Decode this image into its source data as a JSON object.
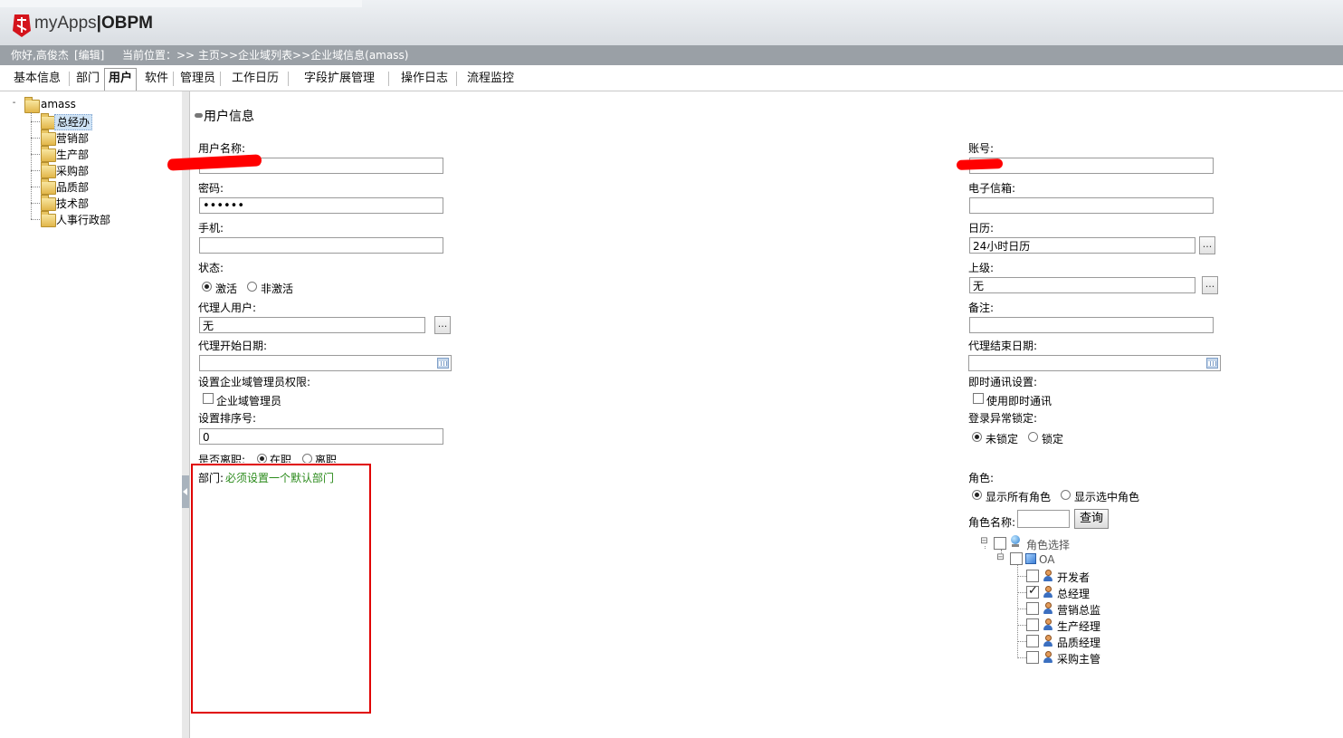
{
  "app": {
    "logo_text": "myApps",
    "logo_separator": "|",
    "product": "OBPM"
  },
  "status_bar": {
    "greeting": "你好,高俊杰",
    "edit_link": "[编辑]",
    "location": "当前位置：>> 主页>>企业域列表>>企业域信息(amass)"
  },
  "tabs": [
    {
      "label": "基本信息"
    },
    {
      "label": "部门"
    },
    {
      "label": "用户",
      "active": true
    },
    {
      "label": "软件"
    },
    {
      "label": "管理员"
    },
    {
      "label": "工作日历"
    },
    {
      "label": "字段扩展管理"
    },
    {
      "label": "操作日志"
    },
    {
      "label": "流程监控"
    }
  ],
  "sidebar": {
    "root": {
      "label": "amass"
    },
    "items": [
      {
        "label": "总经办",
        "selected": true
      },
      {
        "label": "营销部"
      },
      {
        "label": "生产部"
      },
      {
        "label": "采购部"
      },
      {
        "label": "品质部"
      },
      {
        "label": "技术部"
      },
      {
        "label": "人事行政部"
      }
    ]
  },
  "section_title": "用户信息",
  "form_left": {
    "username_label": "用户名称:",
    "username_value": "",
    "password_label": "密码:",
    "password_value": "••••••",
    "mobile_label": "手机:",
    "mobile_value": "",
    "status_label": "状态:",
    "status_options": [
      {
        "label": "激活",
        "checked": true
      },
      {
        "label": "非激活",
        "checked": false
      }
    ],
    "proxy_user_label": "代理人用户:",
    "proxy_user_value": "无",
    "proxy_start_label": "代理开始日期:",
    "proxy_start_value": "",
    "admin_perm_label": "设置企业域管理员权限:",
    "admin_checkbox_label": "企业域管理员",
    "sort_label": "设置排序号:",
    "sort_value": "0",
    "resign_label": "是否离职:",
    "resign_options": [
      {
        "label": "在职",
        "checked": true
      },
      {
        "label": "离职",
        "checked": false
      }
    ],
    "dept_label": "部门:",
    "dept_hint": "必须设置一个默认部门"
  },
  "form_right": {
    "account_label": "账号:",
    "account_value": "",
    "email_label": "电子信箱:",
    "email_value": "",
    "calendar_label": "日历:",
    "calendar_value": "24小时日历",
    "superior_label": "上级:",
    "superior_value": "无",
    "remark_label": "备注:",
    "remark_value": "",
    "proxy_end_label": "代理结束日期:",
    "proxy_end_value": "",
    "im_label": "即时通讯设置:",
    "im_checkbox_label": "使用即时通讯",
    "lock_label": "登录异常锁定:",
    "lock_options": [
      {
        "label": "未锁定",
        "checked": true
      },
      {
        "label": "锁定",
        "checked": false
      }
    ],
    "role_label": "角色:",
    "role_show_options": [
      {
        "label": "显示所有角色",
        "checked": true
      },
      {
        "label": "显示选中角色",
        "checked": false
      }
    ],
    "role_name_label": "角色名称:",
    "role_name_value": "",
    "query_button": "查询",
    "dots_button": "..."
  },
  "role_tree": {
    "root_label": "角色选择",
    "group_label": "OA",
    "roles": [
      {
        "label": "开发者",
        "checked": false
      },
      {
        "label": "总经理",
        "checked": true
      },
      {
        "label": "营销总监",
        "checked": false
      },
      {
        "label": "生产经理",
        "checked": false
      },
      {
        "label": "品质经理",
        "checked": false
      },
      {
        "label": "采购主管",
        "checked": false
      }
    ]
  },
  "icons": {
    "logo": "app-logo-icon",
    "folder": "folder-icon",
    "calendar": "calendar-icon",
    "person": "person-icon",
    "globe": "globe-icon",
    "cube": "cube-icon",
    "collapse": "collapse-icon"
  },
  "colors": {
    "status_bar_bg": "#9aa0a6",
    "hint_green": "#2a8a1a",
    "highlight_red": "#e00000"
  }
}
